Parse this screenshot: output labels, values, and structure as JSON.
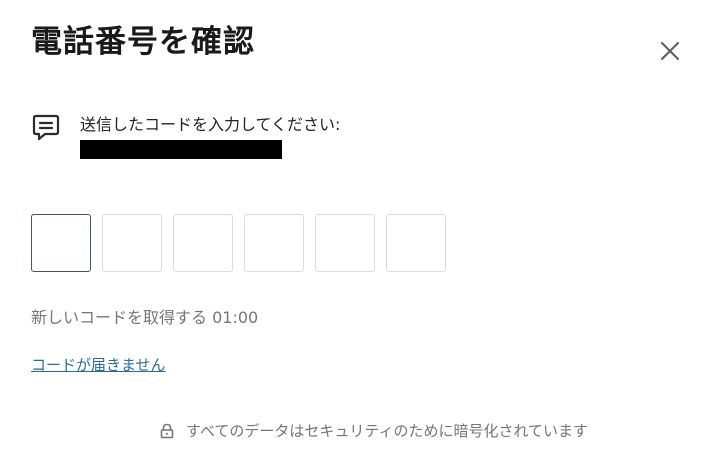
{
  "dialog": {
    "title": "電話番号を確認",
    "close_icon": "close-icon"
  },
  "verification": {
    "message_icon": "chat-message-icon",
    "instruction": "送信したコードを入力してください:",
    "code_length": 6,
    "codes": [
      "",
      "",
      "",
      "",
      "",
      ""
    ],
    "resend_text": "新しいコードを取得する 01:00",
    "no_code_link": "コードが届きません"
  },
  "footer": {
    "lock_icon": "lock-icon",
    "security_text": "すべてのデータはセキュリティのために暗号化されています"
  },
  "colors": {
    "title": "#1a1a1a",
    "active_border": "#3c5b5e",
    "inactive_border": "#dcdcdc",
    "muted_text": "#757575",
    "link": "#2a6b9c"
  }
}
